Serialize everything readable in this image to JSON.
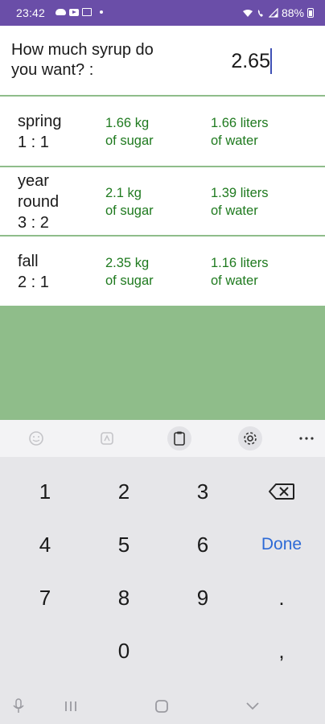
{
  "status_bar": {
    "time": "23:42",
    "battery": "88%"
  },
  "header": {
    "question": "How much syrup do you want? :",
    "amount_value": "2.65"
  },
  "rows": [
    {
      "label_line1": "spring",
      "label_line2": "1 : 1",
      "label_line3": "",
      "sugar_amount": "1.66 kg",
      "sugar_unit": "of sugar",
      "water_amount": "1.66 liters",
      "water_unit": "of water"
    },
    {
      "label_line1": "year",
      "label_line2": "round",
      "label_line3": "3 : 2",
      "sugar_amount": "2.1 kg",
      "sugar_unit": "of sugar",
      "water_amount": "1.39 liters",
      "water_unit": "of water"
    },
    {
      "label_line1": "fall",
      "label_line2": "2 : 1",
      "label_line3": "",
      "sugar_amount": "2.35 kg",
      "sugar_unit": "of sugar",
      "water_amount": "1.16 liters",
      "water_unit": "of water"
    }
  ],
  "keyboard": {
    "toolbar_icons": [
      "emoji-icon",
      "sticker-icon",
      "clipboard-icon",
      "settings-icon",
      "more-icon"
    ],
    "keys": {
      "k1": "1",
      "k2": "2",
      "k3": "3",
      "k4": "4",
      "k5": "5",
      "k6": "6",
      "done": "Done",
      "k7": "7",
      "k8": "8",
      "k9": "9",
      "period": ".",
      "k0": "0",
      "comma": ","
    }
  },
  "colors": {
    "status_bar": "#6a4ea8",
    "accent_green": "#8fbd8a",
    "value_green": "#1f7a1f",
    "done_blue": "#2d6ad6"
  }
}
